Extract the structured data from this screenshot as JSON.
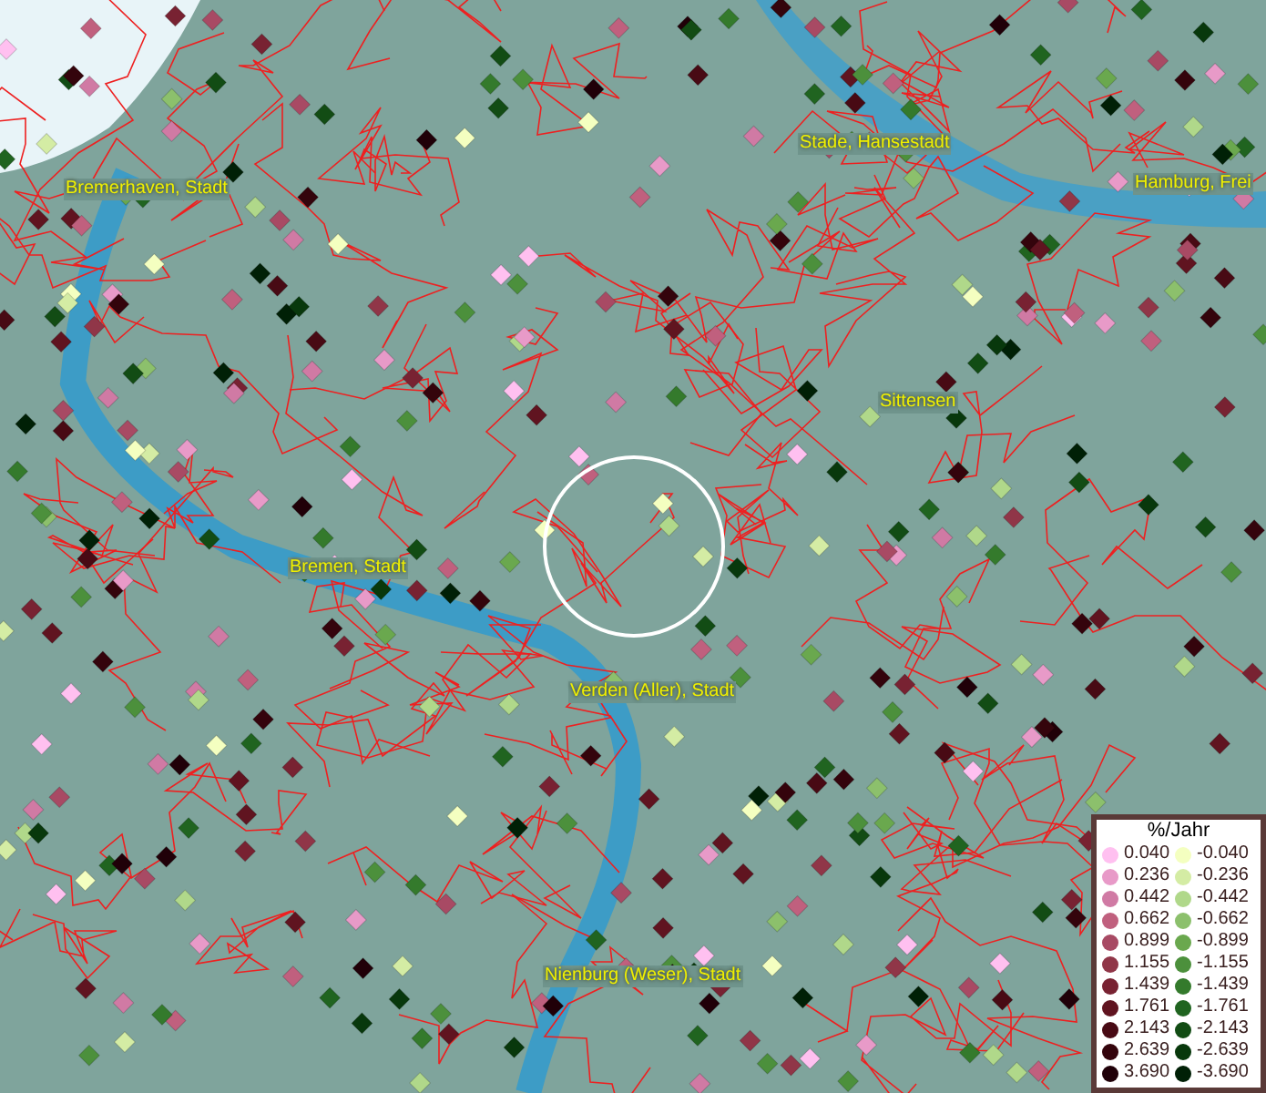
{
  "map": {
    "places": [
      {
        "name": "Bremerhaven, Stadt"
      },
      {
        "name": "Stade, Hansestadt"
      },
      {
        "name": "Hamburg, Frei"
      },
      {
        "name": "Sittensen"
      },
      {
        "name": "Bremen, Stadt"
      },
      {
        "name": "Verden (Aller), Stadt"
      },
      {
        "name": "Nienburg (Weser), Stadt"
      }
    ]
  },
  "legend": {
    "title": "%/Jahr",
    "columns": [
      [
        {
          "label": "0.040",
          "color": "#ffc0f0"
        },
        {
          "label": "0.236",
          "color": "#e89ac8"
        },
        {
          "label": "0.442",
          "color": "#d07aa4"
        },
        {
          "label": "0.662",
          "color": "#c0607e"
        },
        {
          "label": "0.899",
          "color": "#a84a64"
        },
        {
          "label": "1.155",
          "color": "#903648"
        },
        {
          "label": "1.439",
          "color": "#782232"
        },
        {
          "label": "1.761",
          "color": "#601420"
        },
        {
          "label": "2.143",
          "color": "#480a14"
        },
        {
          "label": "2.639",
          "color": "#34040c"
        },
        {
          "label": "3.690",
          "color": "#200008"
        }
      ],
      [
        {
          "label": "-0.040",
          "color": "#f4ffc0"
        },
        {
          "label": "-0.236",
          "color": "#d4eca4"
        },
        {
          "label": "-0.442",
          "color": "#b0d88a"
        },
        {
          "label": "-0.662",
          "color": "#8cc06c"
        },
        {
          "label": "-0.899",
          "color": "#6aa84e"
        },
        {
          "label": "-1.155",
          "color": "#4c903c"
        },
        {
          "label": "-1.439",
          "color": "#347a2c"
        },
        {
          "label": "-1.761",
          "color": "#206420"
        },
        {
          "label": "-2.143",
          "color": "#124c14"
        },
        {
          "label": "-2.639",
          "color": "#08380c"
        },
        {
          "label": "-3.690",
          "color": "#002006"
        }
      ]
    ]
  }
}
